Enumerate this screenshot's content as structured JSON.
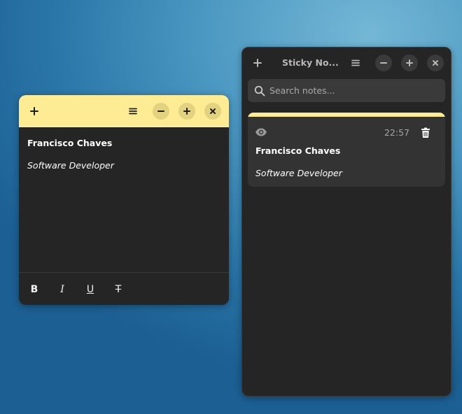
{
  "note_window": {
    "title": "Francisco Chaves",
    "subtitle": "Software Developer",
    "header_icons": [
      "plus-icon",
      "menu-icon",
      "minimize-icon",
      "maximize-icon",
      "close-icon"
    ],
    "format_buttons": {
      "bold": "B",
      "italic": "I",
      "underline": "U",
      "strikethrough": "T"
    },
    "colors": {
      "header": "#fdec94",
      "body": "#252525"
    }
  },
  "main_window": {
    "title": "Sticky No...",
    "header_icons": [
      "plus-icon",
      "menu-icon",
      "minimize-icon",
      "maximize-icon",
      "close-icon"
    ],
    "search": {
      "placeholder": "Search notes...",
      "value": ""
    },
    "notes": [
      {
        "title": "Francisco Chaves",
        "subtitle": "Software Developer",
        "time": "22:57",
        "color": "#fdec94",
        "icons": [
          "eye-icon",
          "trash-icon"
        ]
      }
    ]
  }
}
